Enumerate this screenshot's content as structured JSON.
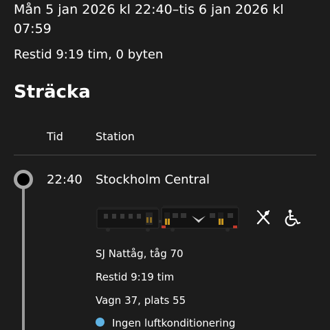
{
  "header": {
    "dates": "Mån 5 jan 2026 kl 22:40–tis 6 jan 2026 kl 07:59",
    "travel_time": "Restid 9:19 tim, 0 byten"
  },
  "section": {
    "title": "Sträcka",
    "col_time": "Tid",
    "col_station": "Station"
  },
  "stop": {
    "time": "22:40",
    "station": "Stockholm Central"
  },
  "train": {
    "image_icon": "night-train-illustration",
    "amenities": [
      "restaurant-icon",
      "wheelchair-icon"
    ]
  },
  "details": {
    "train": "SJ Nattåg, tåg 70",
    "duration": "Restid 9:19 tim",
    "seat": "Vagn 37, plats 55",
    "ac": "Ingen luftkonditionering"
  },
  "colors": {
    "background": "#1c1c1c",
    "accent_dot": "#5fb3e4",
    "route_line": "#9a9a9a"
  }
}
